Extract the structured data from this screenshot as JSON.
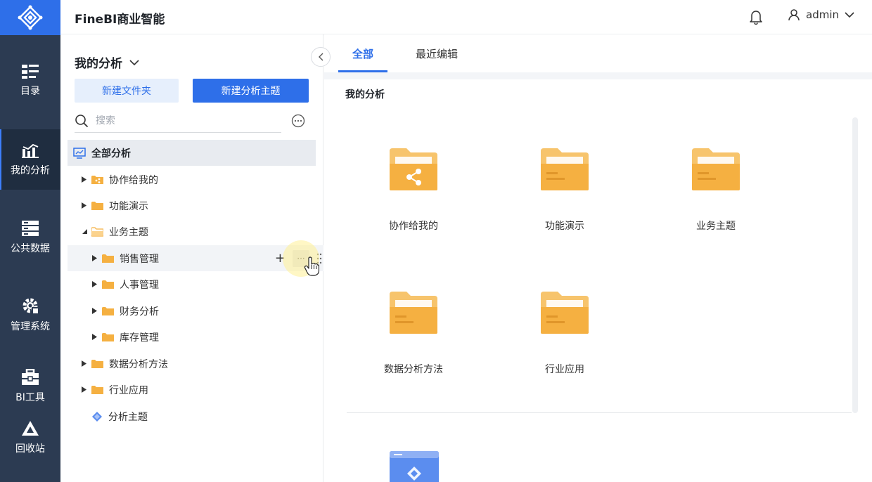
{
  "header": {
    "title": "FineBI商业智能",
    "username": "admin"
  },
  "nav": {
    "items": [
      {
        "label": "目录",
        "icon": "catalog-icon"
      },
      {
        "label": "我的分析",
        "icon": "analysis-icon",
        "active": true
      },
      {
        "label": "公共数据",
        "icon": "database-icon"
      },
      {
        "label": "管理系统",
        "icon": "gear-icon"
      },
      {
        "label": "BI工具",
        "icon": "toolbox-icon"
      },
      {
        "label": "回收站",
        "icon": "recycle-icon"
      }
    ]
  },
  "panel": {
    "title": "我的分析",
    "new_folder_label": "新建文件夹",
    "new_theme_label": "新建分析主题",
    "search_placeholder": "搜索",
    "tree": {
      "root": "全部分析",
      "items": [
        {
          "label": "协作给我的"
        },
        {
          "label": "功能演示"
        },
        {
          "label": "业务主题"
        },
        {
          "label": "销售管理"
        },
        {
          "label": "人事管理"
        },
        {
          "label": "财务分析"
        },
        {
          "label": "库存管理"
        },
        {
          "label": "数据分析方法"
        },
        {
          "label": "行业应用"
        },
        {
          "label": "分析主题"
        }
      ]
    },
    "row_actions": {
      "plus": "+",
      "more": "···"
    }
  },
  "content": {
    "tabs": [
      {
        "label": "全部",
        "active": true
      },
      {
        "label": "最近编辑"
      }
    ],
    "section_title": "我的分析",
    "cards": [
      {
        "label": "协作给我的",
        "icon": "shared-folder-icon"
      },
      {
        "label": "功能演示",
        "icon": "folder-icon"
      },
      {
        "label": "业务主题",
        "icon": "folder-icon"
      },
      {
        "label": "数据分析方法",
        "icon": "folder-icon"
      },
      {
        "label": "行业应用",
        "icon": "folder-icon"
      }
    ]
  },
  "colors": {
    "accent": "#2e6fe9",
    "nav_bg": "#2c3b52",
    "folder": "#f5b041"
  }
}
